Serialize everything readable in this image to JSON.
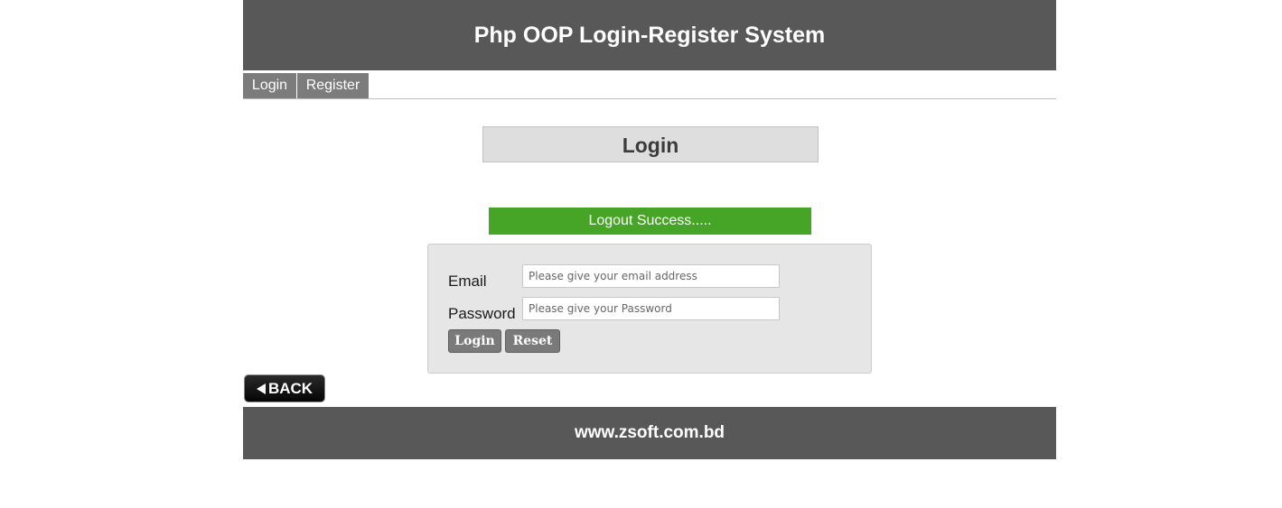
{
  "header": {
    "title": "Php OOP Login-Register System"
  },
  "nav": {
    "items": [
      {
        "label": "Login"
      },
      {
        "label": "Register"
      }
    ]
  },
  "page": {
    "heading": "Login"
  },
  "alert": {
    "message": "Logout Success....."
  },
  "form": {
    "email_label": "Email",
    "email_placeholder": "Please give your email address",
    "email_value": "",
    "password_label": "Password",
    "password_placeholder": "Please give your Password",
    "password_value": "",
    "login_button": "Login",
    "reset_button": "Reset"
  },
  "back_button": {
    "label": "BACK",
    "icon": "left-triangle-icon"
  },
  "footer": {
    "text": "www.zsoft.com.bd"
  },
  "colors": {
    "header_bg": "#585858",
    "nav_bg": "#7c7c7c",
    "alert_bg": "#46a526",
    "form_bg": "#e6e6e6",
    "button_bg": "#7a7a7a"
  }
}
